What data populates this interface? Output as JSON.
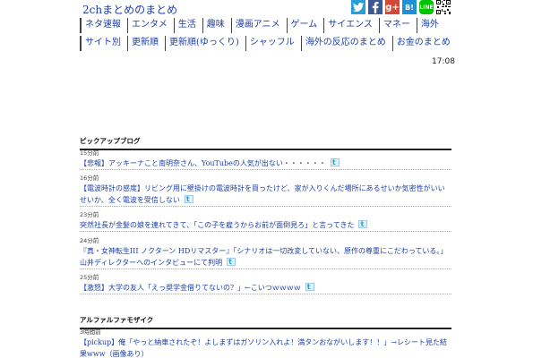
{
  "site": {
    "title": "2chまとめのまとめ"
  },
  "social": [
    "twitter-icon",
    "facebook-icon",
    "google-plus-icon",
    "hatena-bookmark-icon",
    "line-icon",
    "qr-code-icon"
  ],
  "social_labels": {
    "gplus": "g+",
    "hatena": "B!",
    "line": "LINE"
  },
  "nav": {
    "row1": [
      "ネタ速報",
      "エンタメ",
      "生活",
      "趣味",
      "漫画アニメ",
      "ゲーム",
      "サイエンス",
      "マネー",
      "海外"
    ],
    "row2": [
      "サイト別",
      "更新順",
      "更新順(ゆっくり)",
      "シャッフル",
      "海外の反応のまとめ",
      "お金のまとめ"
    ]
  },
  "time": "17:08",
  "pickup": {
    "title": "ピックアップブログ",
    "entries": [
      {
        "ago": "15分前",
        "text": "【悲報】アッキーナこと南明奈さん、YouTubeの人気が出ない・・・・・・"
      },
      {
        "ago": "16分前",
        "text": "【電波時計の感度】リビング用に壁掛けの電波時計を買ったけど、家が入りくんだ場所にあるせいか気密性がいいせいか、全く電波を受信しない"
      },
      {
        "ago": "23分前",
        "text": "突然社長が金髪の娘を連れてきて、「この子を雇うからお前が面倒見ろ」と言ってきた"
      },
      {
        "ago": "24分前",
        "text": "『真・女神転生III ノクターン HDリマスター』「シナリオは一切改変していない、原作の尊重にこだわっている。」山井ディレクターへのインタビューにて判明"
      },
      {
        "ago": "25分前",
        "text": "【激怒】大学の友人「えっ奨学金借りてないの？」←こいつｗｗｗｗ"
      }
    ]
  },
  "alpha": {
    "title": "アルファルファモザイク",
    "entries": [
      {
        "ago": "3時間前",
        "text": "【pickup】俺「やっと納車されたぞ！よしまずはガソリン入れよ！満タンおながいします！！」→レシート見た結果www（画像あり）"
      }
    ]
  },
  "colors": {
    "link": "#1c3fa8",
    "twitter": "#2a9fd6",
    "facebook": "#3b5998",
    "gplus": "#d34836",
    "hatena": "#1f8fd6",
    "line": "#00c300"
  }
}
